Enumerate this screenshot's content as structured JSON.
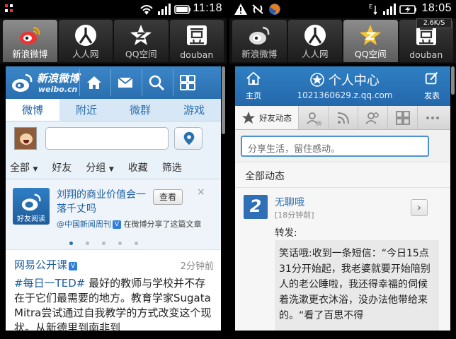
{
  "left": {
    "status": {
      "time": "11:18"
    },
    "apps": [
      {
        "label": "新浪微博",
        "icon": "weibo-icon",
        "active": true
      },
      {
        "label": "人人网",
        "icon": "renren-icon",
        "active": false
      },
      {
        "label": "QQ空间",
        "icon": "qzone-icon",
        "active": false
      },
      {
        "label": "douban",
        "icon": "douban-icon",
        "active": false
      }
    ],
    "weibo": {
      "logo_text": "新浪微博",
      "logo_sub": "weibo.cn",
      "nav": [
        "微博",
        "附近",
        "微群",
        "游戏"
      ],
      "filters": {
        "all": "全部",
        "friends": "好友",
        "group": "分组",
        "fav": "收藏",
        "filter": "筛选"
      },
      "ad": {
        "image_label": "好友阅读",
        "title": "刘翔的商业价值会一落千丈吗",
        "view_button": "查看",
        "close": "×",
        "source_name": "@中国新闻周刊",
        "source_text": "在微博分享了这篇文章"
      },
      "feed": {
        "author": "网易公开课",
        "time": "2分钟前",
        "tag": "#每日一TED#",
        "text": " 最好的教师与学校并不存在于它们最需要的地方。教育学家Sugata Mitra尝试通过自我教学的方式改变这个现状。从新德里到南非到"
      }
    }
  },
  "right": {
    "status": {
      "time": "18:05",
      "speed": "2.6K/S"
    },
    "apps": [
      {
        "label": "新浪微博",
        "icon": "weibo-icon",
        "active": false
      },
      {
        "label": "人人网",
        "icon": "renren-icon",
        "active": false
      },
      {
        "label": "QQ空间",
        "icon": "qzone-icon",
        "active": true
      },
      {
        "label": "douban",
        "icon": "douban-icon",
        "active": false
      }
    ],
    "qzone": {
      "home_label": "主页",
      "title": "个人中心",
      "url": "1021360629.z.qq.com",
      "post_label": "发表",
      "active_tab": "好友动态",
      "composer_placeholder": "分享生活，留住感动。",
      "section_title": "全部动态",
      "feed": {
        "name": "无聊哦",
        "time": "[18分钟前]",
        "forward_label": "转发:",
        "quote": "笑话哦:收到一条短信：“今日15点31分开始起，我老婆就要开始陪别人的老公睡啦，我还得幸福的伺候着洗漱更衣沐浴，没办法他带给来的。“看了百思不得"
      }
    }
  }
}
